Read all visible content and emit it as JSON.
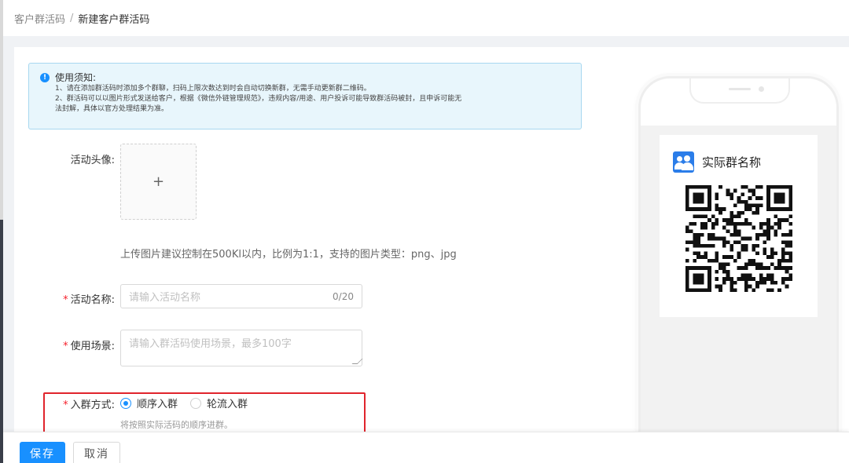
{
  "breadcrumb": {
    "parent": "客户群活码",
    "separator": "/",
    "current": "新建客户群活码"
  },
  "notice": {
    "title": "使用须知:",
    "lines": [
      "1、请在添加群活码时添加多个群聊，扫码上限次数达到时会自动切换新群，无需手动更新群二维码。",
      "2、群活码可以以图片形式发送给客户，根据《微信外链管理规范》，违规内容/用途、用户投诉可能导致群活码被封，且申诉可能无",
      "法封解，具体以官方处理结果为准。"
    ]
  },
  "form": {
    "avatar": {
      "label": "活动头像:",
      "upload_symbol": "+",
      "hint": "上传图片建议控制在500Kl以内，比例为1:1，支持的图片类型：png、jpg"
    },
    "name": {
      "required_mark": "*",
      "label": "活动名称:",
      "placeholder": "请输入活动名称",
      "counter": "0/20"
    },
    "scene": {
      "required_mark": "*",
      "label": "使用场景:",
      "placeholder": "请输入群活码使用场景，最多100字"
    },
    "join_mode": {
      "required_mark": "*",
      "label": "入群方式:",
      "options": [
        {
          "label": "顺序入群",
          "checked": true
        },
        {
          "label": "轮流入群",
          "checked": false
        }
      ],
      "description": "将按照实际活码的顺序进群。"
    }
  },
  "footer": {
    "save_label": "保存",
    "cancel_label": "取消"
  },
  "preview": {
    "group_name": "实际群名称",
    "group_icon": "group-users-icon"
  },
  "colors": {
    "primary": "#1890ff",
    "required": "#f5222d",
    "highlight": "#e0242c",
    "notice_bg": "#e8f6fc",
    "group_icon_bg": "#2b7de9"
  }
}
